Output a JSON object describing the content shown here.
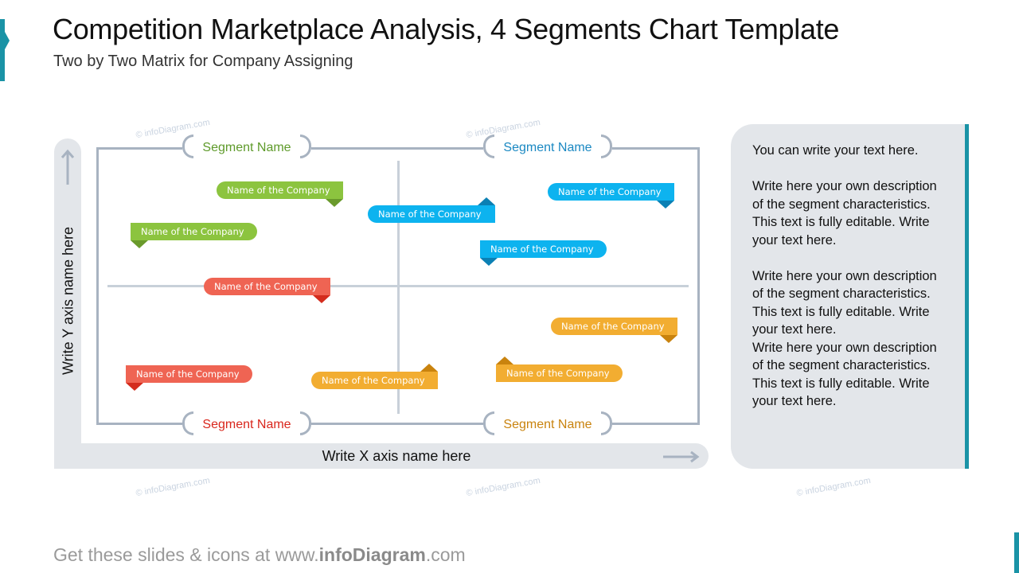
{
  "header": {
    "title": "Competition Marketplace Analysis, 4 Segments Chart Template",
    "subtitle": "Two by Two Matrix for Company Assigning"
  },
  "colors": {
    "accent": "#1a93a6",
    "frame": "#a8b3c1",
    "divider": "#c8d0d9",
    "panel": "#e3e6ea",
    "green": "#8cc43f",
    "green_dark": "#6a9a2c",
    "green_text": "#5e9a2a",
    "blue": "#0db3ef",
    "blue_dark": "#0b80b4",
    "blue_text": "#1a88c2",
    "red": "#ef6453",
    "red_dark": "#d42c1d",
    "red_text": "#d9261c",
    "orange": "#f2ad31",
    "orange_dark": "#c9830e",
    "orange_text": "#c9830e"
  },
  "axes": {
    "y_label": "Write Y axis name here",
    "x_label": "Write X axis name here",
    "y_arrow_icon": "arrow-up-icon",
    "x_arrow_icon": "arrow-right-icon"
  },
  "segments": [
    {
      "id": "top-left",
      "label": "Segment Name",
      "color": "green"
    },
    {
      "id": "top-right",
      "label": "Segment Name",
      "color": "blue"
    },
    {
      "id": "bottom-left",
      "label": "Segment Name",
      "color": "red"
    },
    {
      "id": "bottom-right",
      "label": "Segment Name",
      "color": "orange"
    }
  ],
  "companies": [
    {
      "label": "Name of the Company",
      "quadrant": "top-left",
      "color": "green"
    },
    {
      "label": "Name of the Company",
      "quadrant": "top-left",
      "color": "green"
    },
    {
      "label": "Name of the Company",
      "quadrant": "top-right",
      "color": "blue"
    },
    {
      "label": "Name of the Company",
      "quadrant": "top-right",
      "color": "blue"
    },
    {
      "label": "Name of the Company",
      "quadrant": "top-right",
      "color": "blue"
    },
    {
      "label": "Name of the Company",
      "quadrant": "bottom-left",
      "color": "red"
    },
    {
      "label": "Name of the Company",
      "quadrant": "bottom-left",
      "color": "red"
    },
    {
      "label": "Name of the Company",
      "quadrant": "bottom-right",
      "color": "orange"
    },
    {
      "label": "Name of the Company",
      "quadrant": "bottom-right",
      "color": "orange"
    },
    {
      "label": "Name of the Company",
      "quadrant": "bottom-right",
      "color": "orange"
    }
  ],
  "side_panel": {
    "intro": "You can write your text here.",
    "paragraphs": [
      "Write here your own description of the segment characteristics. This text is fully editable.  Write your text here.",
      "Write here your own description of the segment characteristics. This text is fully editable.  Write your text here.",
      "Write here your own description of the segment characteristics. This text is fully editable.  Write your text here."
    ]
  },
  "watermark": "© infoDiagram.com",
  "footer": {
    "prefix": "Get these slides & icons at www.",
    "brand": "infoDiagram",
    "suffix": ".com"
  }
}
